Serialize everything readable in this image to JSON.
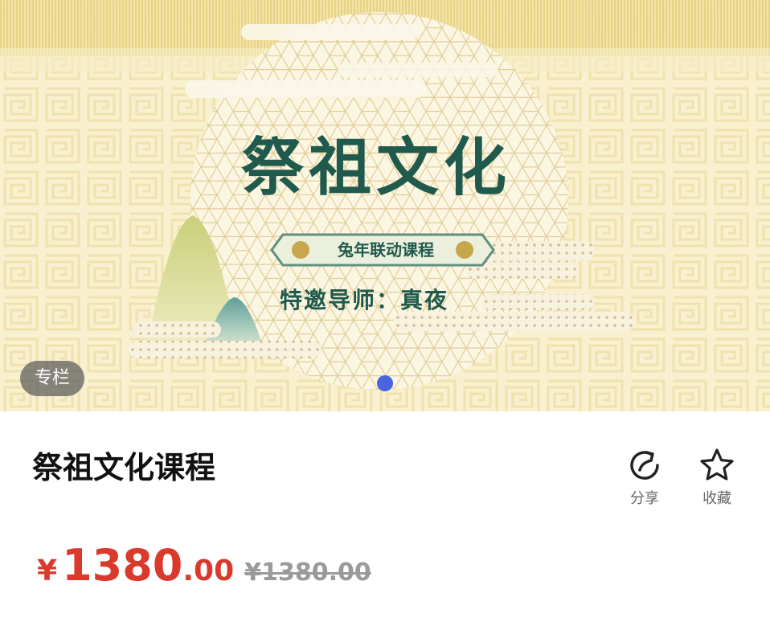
{
  "banner": {
    "title": "祭祖文化",
    "subtitle": "兔年联动课程",
    "mentor": "特邀导师：真夜",
    "tag": "专栏",
    "carousel": {
      "total": 1,
      "active": 1
    }
  },
  "course": {
    "title": "祭祖文化课程"
  },
  "actions": {
    "share_label": "分享",
    "favorite_label": "收藏"
  },
  "price": {
    "currency_symbol": "¥",
    "current_integer": "1380",
    "current_decimal": ".00",
    "original": "¥1380.00"
  },
  "colors": {
    "accent_price": "#d93a2b",
    "banner_text": "#1f5a4d",
    "banner_bg": "#f7eec6",
    "dot_active": "#4a63df"
  },
  "icons": {
    "share": "share-icon",
    "favorite": "star-icon"
  }
}
